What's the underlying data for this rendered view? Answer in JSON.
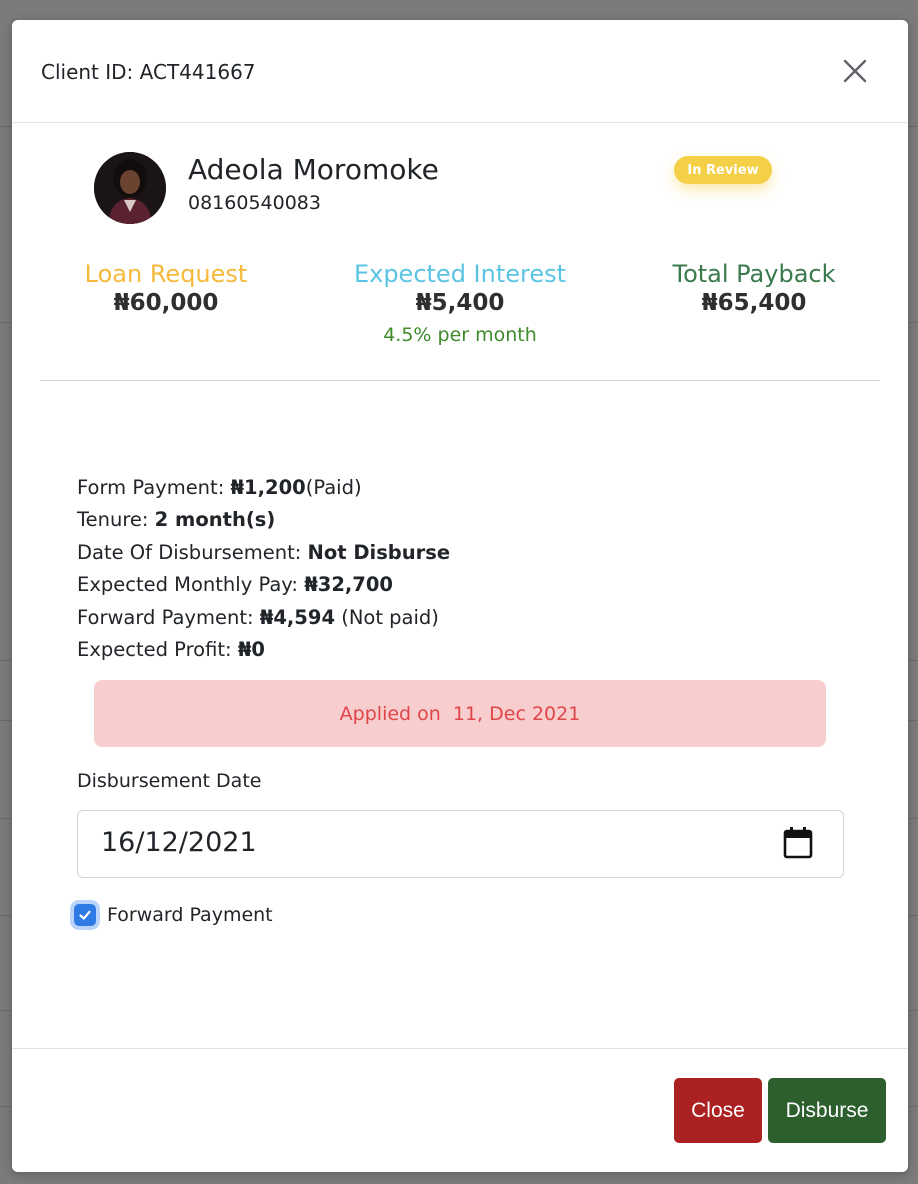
{
  "modal": {
    "client_id": "Client ID: ACT441667",
    "client_name": "Adeola Moromoke",
    "client_phone": "08160540083",
    "status_badge": "In Review",
    "stats": {
      "loan_label": "Loan Request",
      "loan_value": "₦60,000",
      "interest_label": "Expected Interest",
      "interest_value": "₦5,400",
      "interest_note": "4.5% per month",
      "payback_label": "Total Payback",
      "payback_value": "₦65,400"
    },
    "details": {
      "form_payment_label": "Form Payment: ",
      "form_payment_value": "₦1,200",
      "form_payment_status": "(Paid)",
      "tenure_label": "Tenure: ",
      "tenure_value": "2 month(s)",
      "disbursement_label": "Date Of Disbursement: ",
      "disbursement_value": "Not Disburse",
      "monthly_pay_label": "Expected Monthly Pay: ",
      "monthly_pay_value": "₦32,700",
      "forward_payment_label": "Forward Payment: ",
      "forward_payment_value": "₦4,594",
      "forward_payment_status": " (Not paid)",
      "profit_label": "Expected Profit: ",
      "profit_value": "₦0"
    },
    "applied_alert": "Applied on  11, Dec 2021",
    "disbursement_date_label": "Disbursement Date",
    "disbursement_date_value": "16/12/2021",
    "forward_payment_checkbox_label": "Forward Payment",
    "forward_payment_checked": true,
    "close_button": "Close",
    "disburse_button": "Disburse"
  },
  "colors": {
    "loan": "#f6b93b",
    "interest": "#5bc4e4",
    "payback": "#3a7a4d",
    "badge": "#f3d046",
    "close_button": "#ab2121",
    "disburse_button": "#2c5f2d",
    "alert_bg": "#f8cdcd",
    "alert_text": "#e0454a",
    "checkbox": "#2f7ae5"
  }
}
